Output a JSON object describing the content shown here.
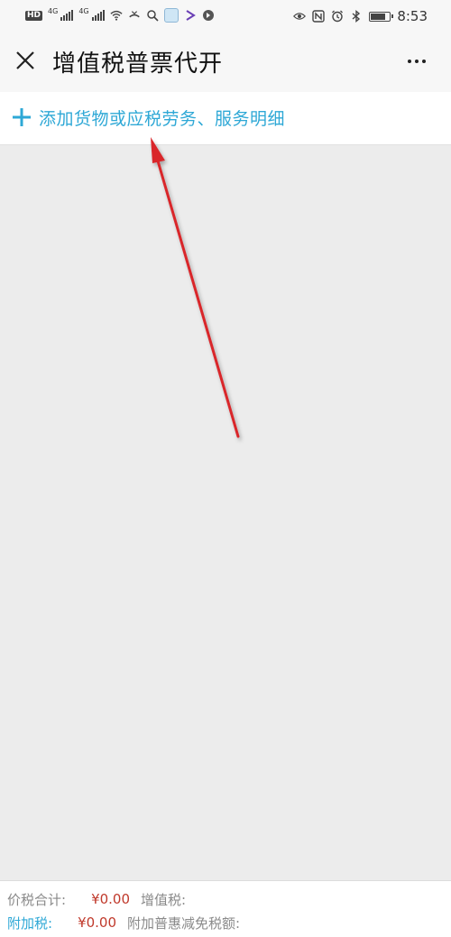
{
  "status_bar": {
    "hd_badge": "HD",
    "net1": "4G",
    "net2": "4G",
    "time": "8:53"
  },
  "header": {
    "title": "增值税普票代开"
  },
  "add_item": {
    "label": "添加货物或应税劳务、服务明细"
  },
  "footer": {
    "total_label": "价税合计:",
    "total_value": "¥0.00",
    "vat_label": "增值税:",
    "surcharge_label": "附加税:",
    "surcharge_value": "¥0.00",
    "relief_label": "附加普惠减免税额:"
  },
  "colors": {
    "accent": "#2ea8d6",
    "amount": "#c0392b",
    "annotation_arrow": "#d9262b"
  },
  "icons": [
    "close-icon",
    "more-icon",
    "plus-icon",
    "wifi-icon",
    "eye-icon",
    "nfc-icon",
    "alarm-icon",
    "bluetooth-icon",
    "battery-icon"
  ]
}
